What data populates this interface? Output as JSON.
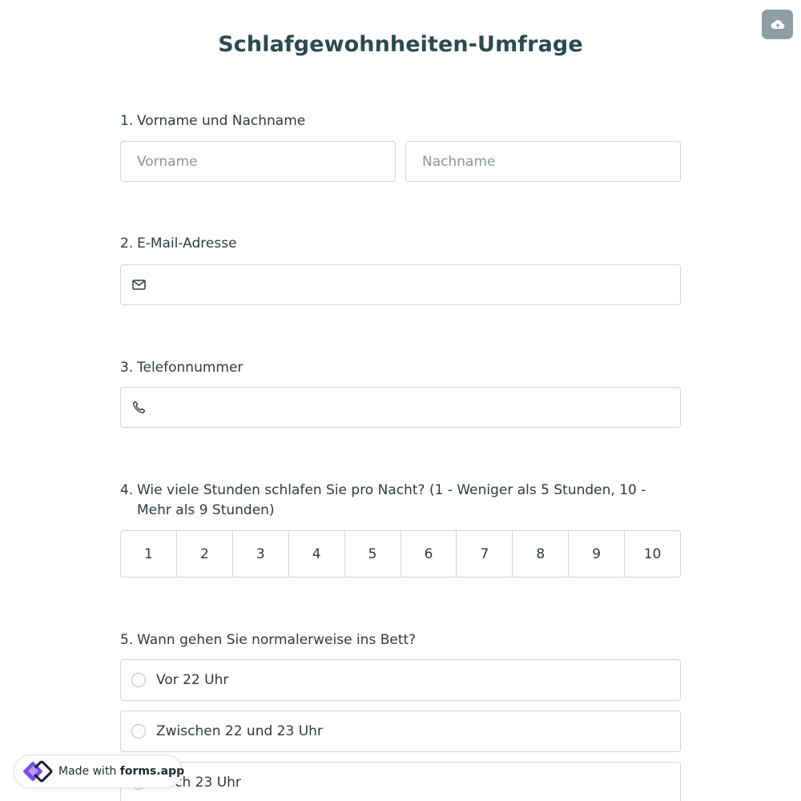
{
  "title": "Schlafgewohnheiten-Umfrage",
  "save_icon": "cloud-upload-icon",
  "questions": [
    {
      "number": "1.",
      "label": "Vorname und Nachname",
      "first_name_placeholder": "Vorname",
      "last_name_placeholder": "Nachname"
    },
    {
      "number": "2.",
      "label": "E-Mail-Adresse",
      "icon": "envelope-icon",
      "value": ""
    },
    {
      "number": "3.",
      "label": "Telefonnummer",
      "icon": "phone-icon",
      "value": ""
    },
    {
      "number": "4.",
      "label": "Wie viele Stunden schlafen Sie pro Nacht? (1 - Weniger als 5 Stunden, 10 - Mehr als 9 Stunden)",
      "scale": [
        "1",
        "2",
        "3",
        "4",
        "5",
        "6",
        "7",
        "8",
        "9",
        "10"
      ]
    },
    {
      "number": "5.",
      "label": "Wann gehen Sie normalerweise ins Bett?",
      "options": [
        "Vor 22 Uhr",
        "Zwischen 22 und 23 Uhr",
        "Nach 23 Uhr"
      ]
    }
  ],
  "badge": {
    "made_with": "Made with",
    "brand": "forms.app"
  },
  "colors": {
    "title": "#2b4a4f",
    "save_button": "#8e9ea4",
    "border": "#cfd5d8",
    "logo_purple": "#7a4fe6"
  }
}
